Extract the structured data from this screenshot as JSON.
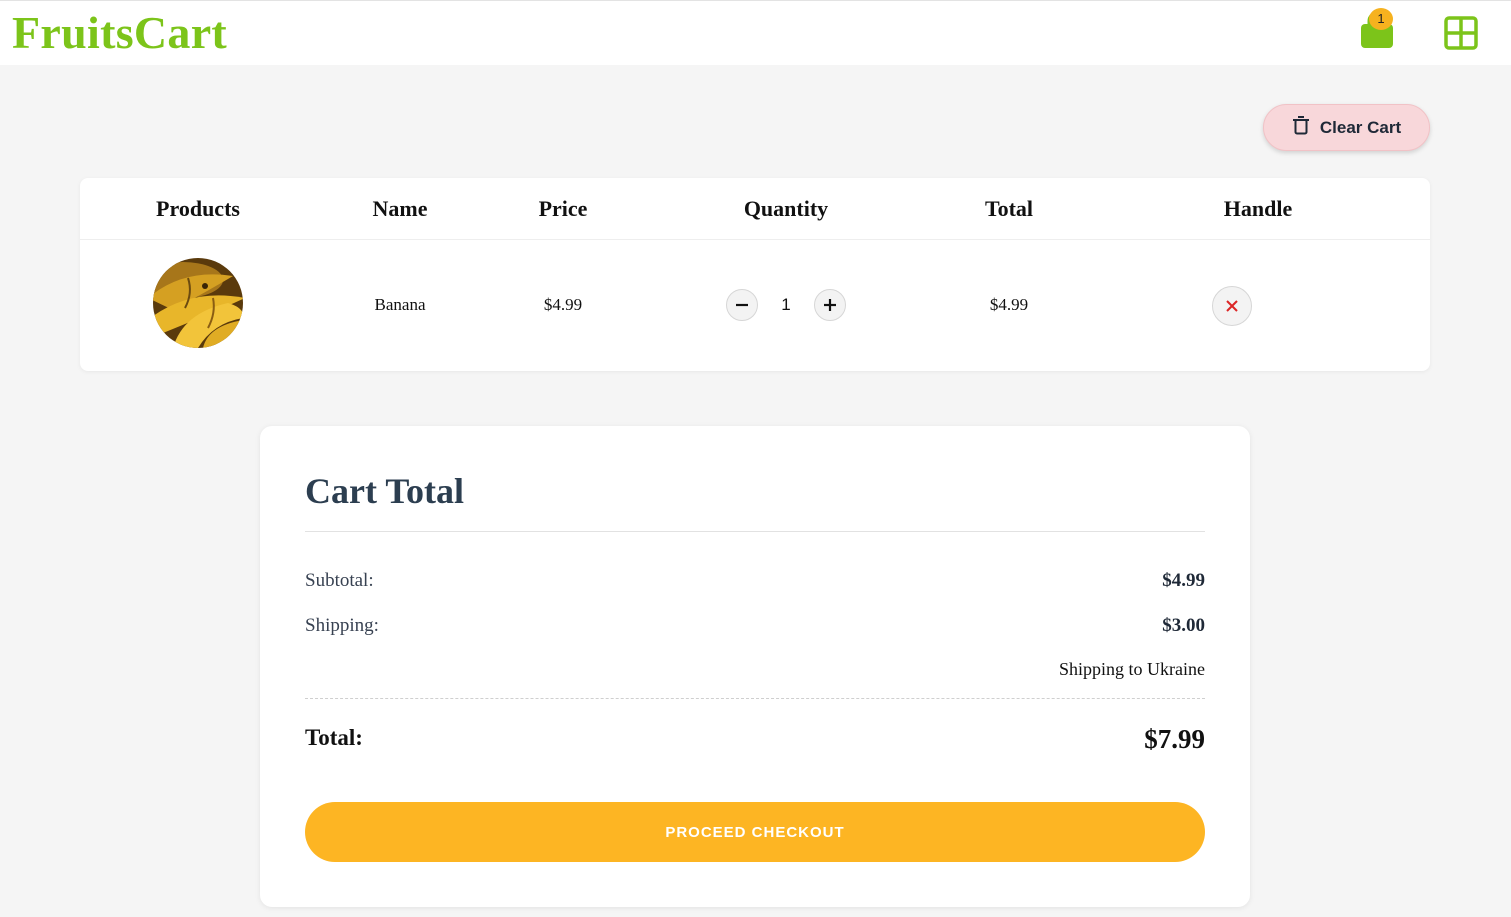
{
  "header": {
    "logo": "FruitsCart",
    "cart_count": "1",
    "cart_icon": "shopping-bag-icon",
    "menu_icon": "grid-icon",
    "brand_color": "#7cc41a"
  },
  "actions": {
    "clear_cart_label": "Clear Cart",
    "clear_cart_icon": "trash-icon"
  },
  "table": {
    "columns": [
      "Products",
      "Name",
      "Price",
      "Quantity",
      "Total",
      "Handle"
    ],
    "rows": [
      {
        "image": "banana-image",
        "name": "Banana",
        "price": "$4.99",
        "quantity": "1",
        "total": "$4.99"
      }
    ]
  },
  "summary": {
    "title": "Cart Total",
    "subtotal_label": "Subtotal:",
    "subtotal_value": "$4.99",
    "shipping_label": "Shipping:",
    "shipping_value": "$3.00",
    "shipping_note": "Shipping to Ukraine",
    "total_label": "Total:",
    "total_value": "$7.99",
    "checkout_label": "PROCEED CHECKOUT",
    "accent_color": "#fdb523"
  }
}
